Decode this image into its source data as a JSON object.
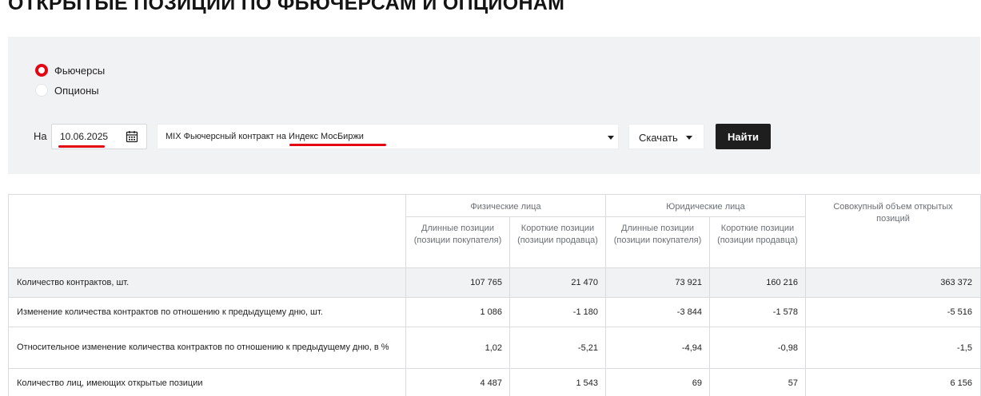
{
  "page": {
    "title": "ОТКРЫТЫЕ ПОЗИЦИИ ПО ФЬЮЧЕРСАМ И ОПЦИОНАМ"
  },
  "filters": {
    "instrument_options": [
      {
        "label": "Фьючерсы",
        "selected": true
      },
      {
        "label": "Опционы",
        "selected": false
      }
    ],
    "date_prefix": "На",
    "date_value": "10.06.2025",
    "contract_prefix": "MIX Фьючерсный контракт на ",
    "contract_name": "Индекс МосБиржи",
    "download_label": "Скачать",
    "find_label": "Найти"
  },
  "accent_color": "#e30613",
  "table": {
    "groups": {
      "individuals": "Физические лица",
      "legal": "Юридические лица",
      "total": "Совокупный объем открытых позиций"
    },
    "subheaders": {
      "long": "Длинные позиции (позиции покупателя)",
      "short": "Короткие позиции (позиции продавца)"
    },
    "rows": [
      {
        "label": "Количество контрактов, шт.",
        "values": [
          "107 765",
          "21 470",
          "73 921",
          "160 216",
          "363 372"
        ]
      },
      {
        "label": "Изменение количества контрактов по отношению к предыдущему дню, шт.",
        "values": [
          "1 086",
          "-1 180",
          "-3 844",
          "-1 578",
          "-5 516"
        ]
      },
      {
        "label": "Относительное изменение количества контрактов по отношению к предыдущему дню, в %",
        "values": [
          "1,02",
          "-5,21",
          "-4,94",
          "-0,98",
          "-1,5"
        ]
      },
      {
        "label": "Количество лиц, имеющих открытые позиции",
        "values": [
          "4 487",
          "1 543",
          "69",
          "57",
          "6 156"
        ]
      }
    ]
  }
}
